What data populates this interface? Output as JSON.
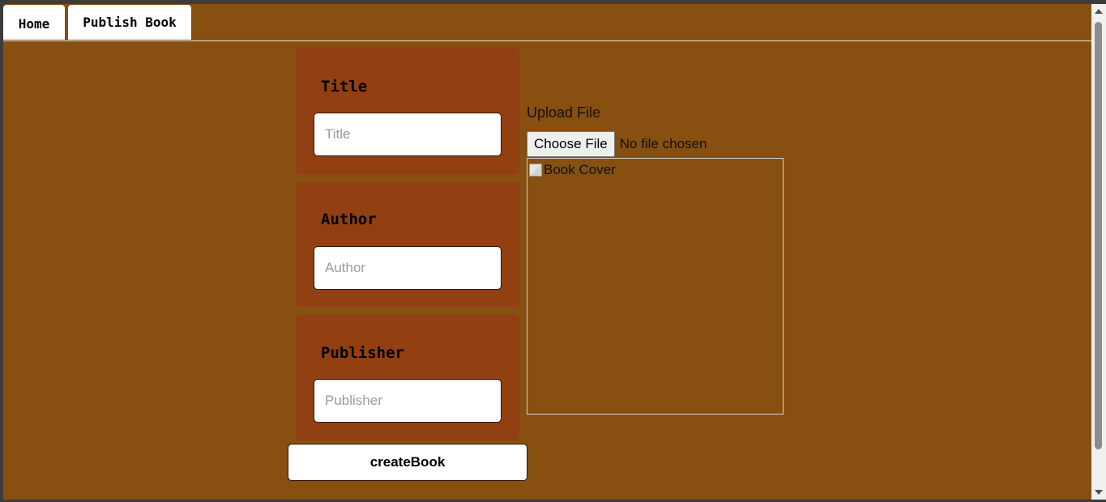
{
  "nav": {
    "tabs": [
      {
        "label": "Home"
      },
      {
        "label": "Publish Book"
      }
    ]
  },
  "form": {
    "title": {
      "label": "Title",
      "placeholder": "Title",
      "value": ""
    },
    "author": {
      "label": "Author",
      "placeholder": "Author",
      "value": ""
    },
    "publisher": {
      "label": "Publisher",
      "placeholder": "Publisher",
      "value": ""
    },
    "submit_label": "createBook"
  },
  "upload": {
    "label": "Upload File",
    "button_label": "Choose File",
    "status": "No file chosen",
    "cover_alt": "Book Cover"
  },
  "colors": {
    "page_background": "#874f10",
    "card_background": "#923f12"
  }
}
